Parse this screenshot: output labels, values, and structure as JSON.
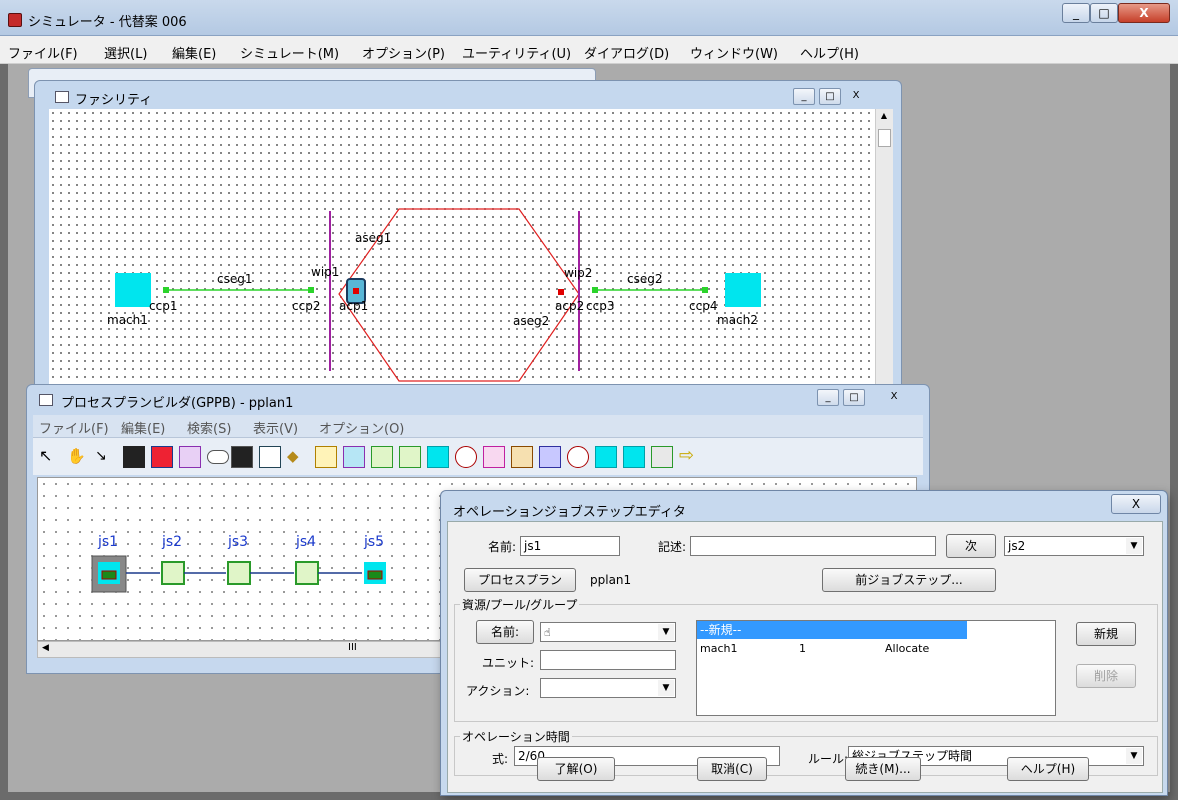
{
  "main_window": {
    "title": "シミュレータ - 代替案 006",
    "menu": [
      "ファイル(F)",
      "選択(L)",
      "編集(E)",
      "シミュレート(M)",
      "オプション(P)",
      "ユーティリティ(U)",
      "ダイアログ(D)",
      "ウィンドウ(W)",
      "ヘルプ(H)"
    ],
    "close_glyph": "X",
    "min_glyph": "_",
    "max_glyph": "□"
  },
  "facility": {
    "title": "ファシリティ",
    "labels": {
      "aseg1": "aseg1",
      "aseg2": "aseg2",
      "wip1": "wip1",
      "wip2": "wip2",
      "cseg1": "cseg1",
      "cseg2": "cseg2",
      "ccp1": "ccp1",
      "ccp2": "ccp2",
      "ccp3": "ccp3",
      "ccp4": "ccp4",
      "acp1": "acp1",
      "acp2": "acp2",
      "mach1": "mach1",
      "mach2": "mach2"
    },
    "colors": {
      "machine": "#00e5ee",
      "segment": "#2bd32b",
      "hexagon": "#e02020",
      "wip": "#a020a0",
      "point": "#e00000"
    }
  },
  "gppb": {
    "title": "プロセスプランビルダ(GPPB) - pplan1",
    "menu": [
      "ファイル(F)",
      "編集(E)",
      "検索(S)",
      "表示(V)",
      "オプション(O)"
    ],
    "steps": [
      "js1",
      "js2",
      "js3",
      "js4",
      "js5"
    ],
    "scroll_marker": "III"
  },
  "op_dialog": {
    "title": "オペレーションジョブステップエディタ",
    "close_glyph": "X",
    "name_label": "名前:",
    "name_value": "js1",
    "desc_label": "記述:",
    "desc_value": "",
    "next_button": "次",
    "next_value": "js2",
    "process_plan_button": "プロセスプラン",
    "process_plan_value": "pplan1",
    "prev_step_button": "前ジョブステップ...",
    "resource_group_title": "資源/プール/グループ",
    "resource_name_button": "名前:",
    "unit_label": "ユニット:",
    "unit_value": "",
    "action_label": "アクション:",
    "action_value": "",
    "list_header": "--新規--",
    "list_rows": [
      {
        "name": "mach1",
        "unit": "1",
        "action": "Allocate"
      }
    ],
    "new_button": "新規",
    "delete_button": "削除",
    "op_time_title": "オペレーション時間",
    "expr_label": "式:",
    "expr_value": "2/60",
    "rule_label": "ルール:",
    "rule_value": "総ジョブステップ時間",
    "ok_button": "了解(O)",
    "cancel_button": "取消(C)",
    "continue_button": "続き(M)...",
    "help_button": "ヘルプ(H)"
  }
}
